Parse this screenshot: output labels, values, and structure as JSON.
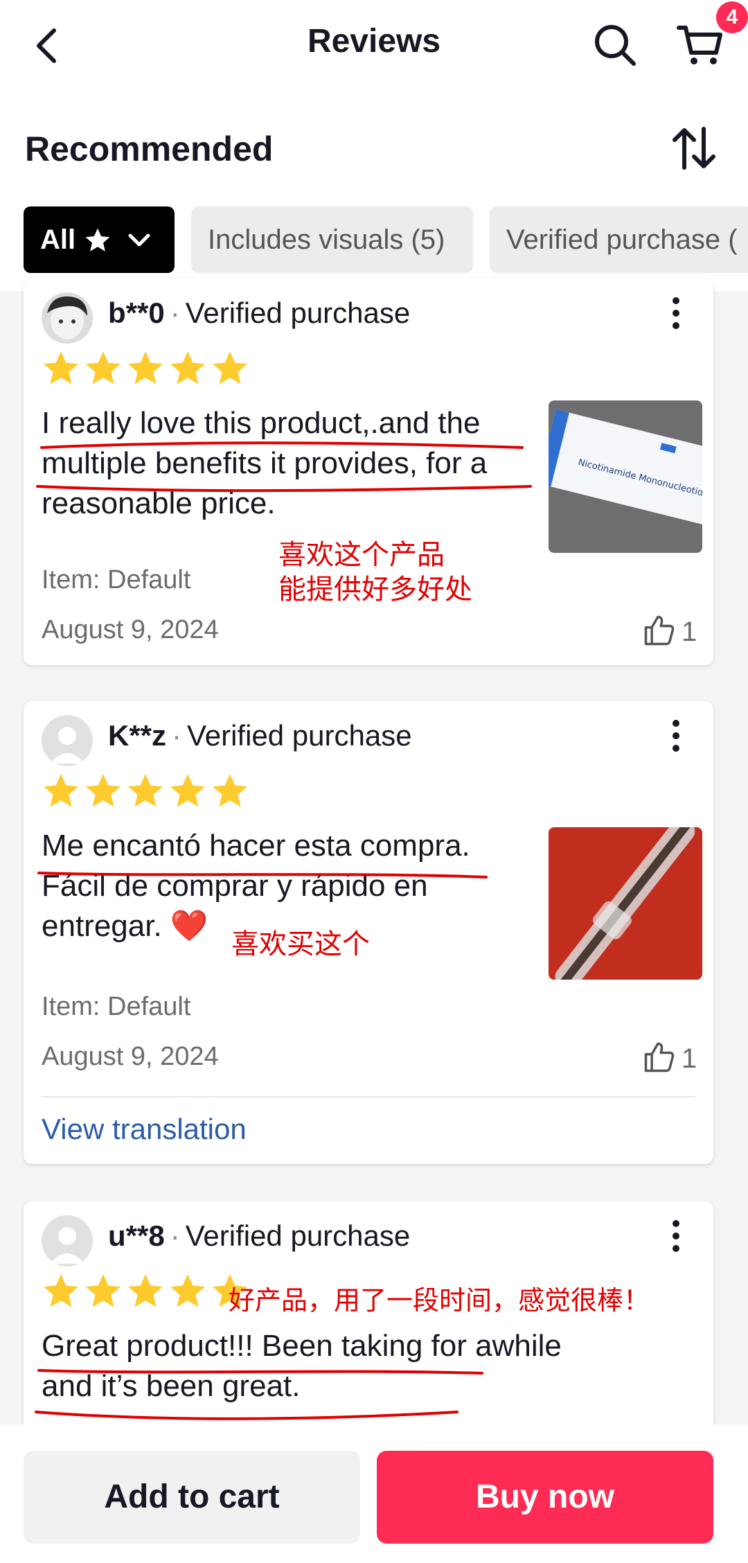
{
  "header": {
    "title": "Reviews",
    "cart_badge": "4"
  },
  "sort": {
    "label": "Recommended"
  },
  "filters": {
    "all_label": "All",
    "visuals": "Includes visuals (5)",
    "verified": "Verified purchase ("
  },
  "reviews": [
    {
      "user": "b**0",
      "badge": "Verified purchase",
      "rating": 5,
      "text": "I really love this product,.and the multiple benefits it provides, for a reasonable price.",
      "photo_caption": "Nicotinamide Mononucleotide",
      "item": "Item: Default",
      "date": "August 9, 2024",
      "likes": "1",
      "note_lines": [
        "喜欢这个产品",
        "能提供好多好处"
      ]
    },
    {
      "user": "K**z",
      "badge": "Verified purchase",
      "rating": 5,
      "text": "Me encantó hacer esta compra. Fácil de comprar y rápido en entregar.",
      "emoji": "❤️",
      "item": "Item: Default",
      "date": "August 9, 2024",
      "likes": "1",
      "note": "喜欢买这个",
      "view_translation": "View translation"
    },
    {
      "user": "u**8",
      "badge": "Verified purchase",
      "rating": 5,
      "text": "Great product!!! Been taking for awhile and it’s been great.",
      "note": "好产品，用了一段时间，感觉很棒！"
    }
  ],
  "actions": {
    "add_to_cart": "Add to cart",
    "buy_now": "Buy now"
  },
  "colors": {
    "accent": "#fe2c55",
    "star": "#fecb2f",
    "annotation": "#e10000",
    "link": "#2b5ca8"
  }
}
